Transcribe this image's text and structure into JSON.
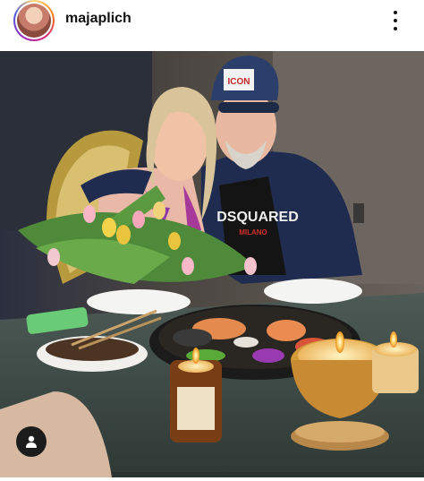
{
  "post": {
    "username": "majaplich",
    "avatar_icon": "profile-photo",
    "more_icon": "more-vertical-icon",
    "tag_icon": "user-tag-icon"
  },
  "photo_icons": [
    "tulips-bouquet",
    "candles",
    "sushi-platter",
    "couple"
  ],
  "cap_text": "ICON",
  "shirt_text": "DSQUARED",
  "shirt_subtext": "MILANO"
}
